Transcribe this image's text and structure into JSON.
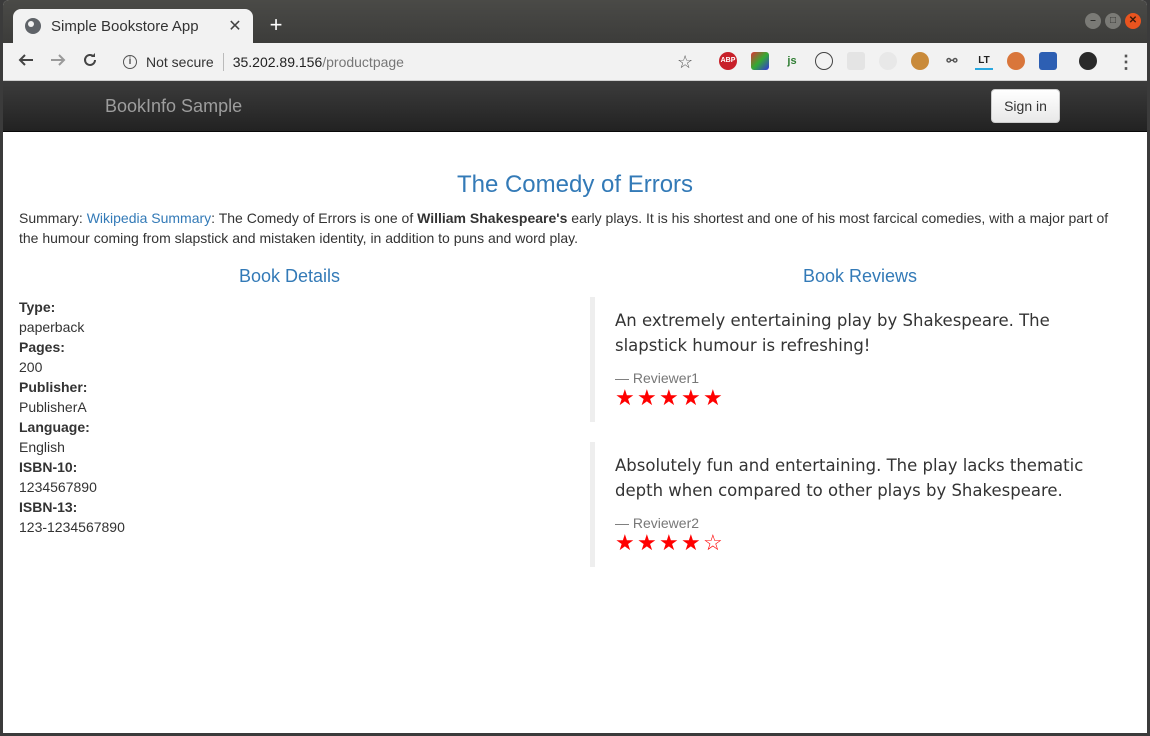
{
  "browser": {
    "tab_title": "Simple Bookstore App",
    "tab_close": "✕",
    "new_tab": "+",
    "security_label": "Not secure",
    "url_host": "35.202.89.156",
    "url_path": "/productpage",
    "extensions": [
      "ABP",
      "",
      "js",
      "",
      "",
      "",
      "",
      "",
      "LT",
      "",
      ""
    ]
  },
  "navbar": {
    "brand": "BookInfo Sample",
    "signin_label": "Sign in"
  },
  "book": {
    "title": "The Comedy of Errors",
    "summary_prefix": "Summary: ",
    "summary_link": "Wikipedia Summary",
    "summary_mid": ": The Comedy of Errors is one of ",
    "summary_bold": "William Shakespeare's",
    "summary_rest": " early plays. It is his shortest and one of his most farcical comedies, with a major part of the humour coming from slapstick and mistaken identity, in addition to puns and word play."
  },
  "details": {
    "heading": "Book Details",
    "items": [
      {
        "label": "Type:",
        "value": "paperback"
      },
      {
        "label": "Pages:",
        "value": "200"
      },
      {
        "label": "Publisher:",
        "value": "PublisherA"
      },
      {
        "label": "Language:",
        "value": "English"
      },
      {
        "label": "ISBN-10:",
        "value": "1234567890"
      },
      {
        "label": "ISBN-13:",
        "value": "123-1234567890"
      }
    ]
  },
  "reviews": {
    "heading": "Book Reviews",
    "items": [
      {
        "text": "An extremely entertaining play by Shakespeare. The slapstick humour is refreshing!",
        "reviewer": "— Reviewer1",
        "rating": 5
      },
      {
        "text": "Absolutely fun and entertaining. The play lacks thematic depth when compared to other plays by Shakespeare.",
        "reviewer": "— Reviewer2",
        "rating": 4
      }
    ],
    "star_color": "#ff0000"
  }
}
